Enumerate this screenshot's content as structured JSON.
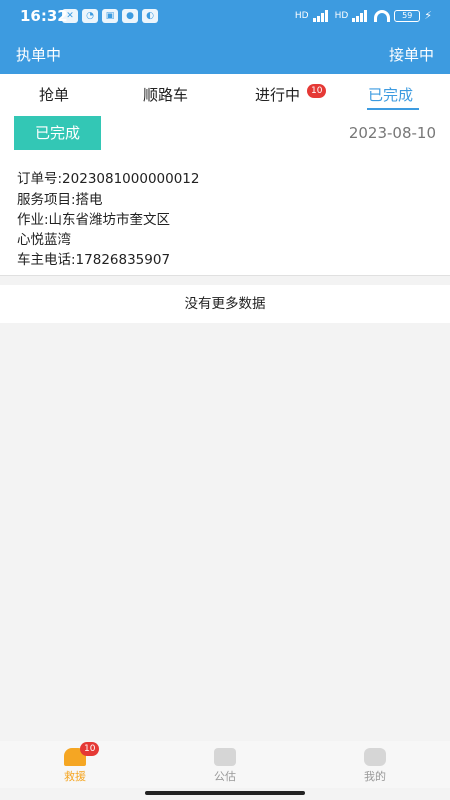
{
  "statusbar": {
    "time": "16:32",
    "left_icons": [
      "mute-icon",
      "alarm-icon",
      "app-notification-icon",
      "qq-icon",
      "app-icon"
    ],
    "battery": "59",
    "network_labels": [
      "HD",
      "HD"
    ]
  },
  "appbar": {
    "left_label": "执单中",
    "right_label": "接单中"
  },
  "tabs": [
    {
      "label": "抢单"
    },
    {
      "label": "顺路车"
    },
    {
      "label": "进行中",
      "badge": "10"
    },
    {
      "label": "已完成",
      "active": true
    }
  ],
  "order": {
    "status": "已完成",
    "date": "2023-08-10",
    "order_no": "订单号:2023081000000012",
    "service": "服务项目:搭电",
    "location_line1": "作业:山东省潍坊市奎文区",
    "location_line2": "心悦蓝湾",
    "phone": "车主电话:17826835907"
  },
  "list_footer": "没有更多数据",
  "bottom_nav": [
    {
      "label": "救援",
      "badge": "10",
      "icon": "rescue-icon",
      "active": true
    },
    {
      "label": "公估",
      "icon": "assessment-icon"
    },
    {
      "label": "我的",
      "icon": "profile-icon"
    }
  ],
  "colors": {
    "primary": "#3d9be0",
    "status_green": "#33c7b5",
    "accent_orange": "#f5a623",
    "badge_red": "#e53935"
  }
}
